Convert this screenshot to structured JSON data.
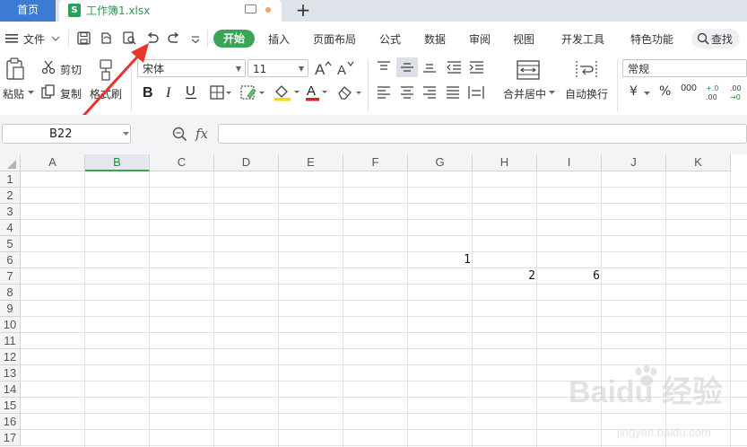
{
  "tabs": {
    "home": "首页",
    "file_icon": "S",
    "file_name": "工作簿1.xlsx",
    "add": "+"
  },
  "menu": {
    "file": "文件",
    "start": "开始",
    "items": [
      "插入",
      "页面布局",
      "公式",
      "数据",
      "审阅",
      "视图",
      "开发工具",
      "特色功能"
    ],
    "search": "查找"
  },
  "ribbon": {
    "paste": "粘贴",
    "cut": "剪切",
    "copy": "复制",
    "format_painter": "格式刷",
    "font_name": "宋体",
    "font_size": "11",
    "merge_center": "合并居中",
    "wrap_text": "自动换行",
    "number_format": "常规",
    "currency": "¥",
    "percent": "%",
    "thousands": "000"
  },
  "formula": {
    "name_box": "B22",
    "fx": "fx",
    "content": ""
  },
  "sheet": {
    "columns": [
      "A",
      "B",
      "C",
      "D",
      "E",
      "F",
      "G",
      "H",
      "I",
      "J",
      "K"
    ],
    "selected_column": "B",
    "rows": [
      "1",
      "2",
      "3",
      "4",
      "5",
      "6",
      "7",
      "8",
      "9",
      "10",
      "11",
      "12",
      "13",
      "14",
      "15",
      "16",
      "17"
    ],
    "cells": [
      {
        "ref": "G6",
        "value": "1"
      },
      {
        "ref": "H7",
        "value": "2"
      },
      {
        "ref": "I7",
        "value": "6"
      }
    ]
  },
  "watermark": {
    "brand": "Baidu 经验",
    "url": "jingyan.baidu.com"
  },
  "colors": {
    "accent_green": "#3aa457",
    "tab_blue": "#3b7bd4",
    "arrow_red": "#e8352b"
  }
}
